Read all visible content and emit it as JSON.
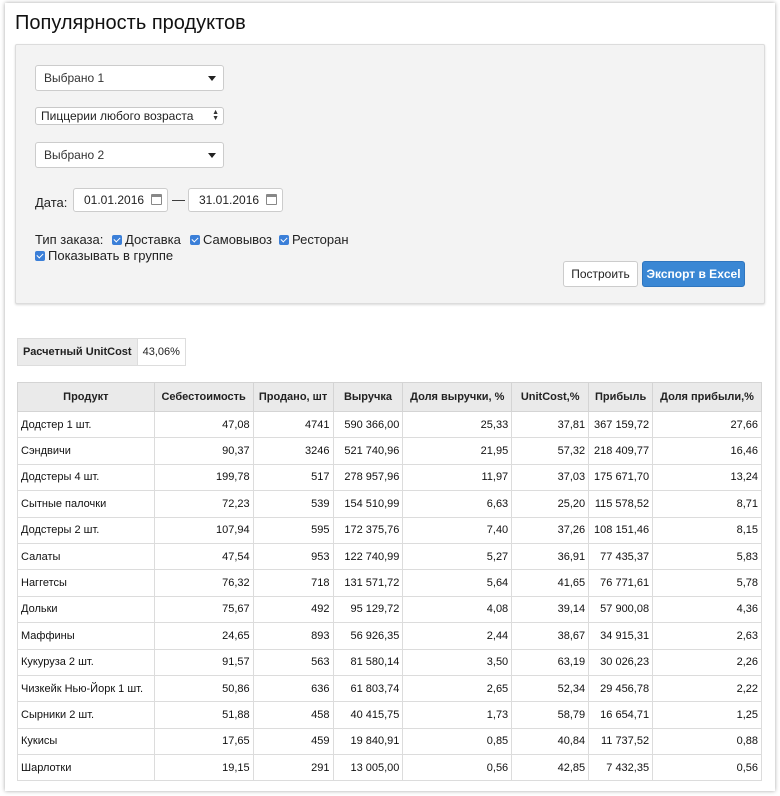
{
  "page": {
    "title": "Популярность продуктов"
  },
  "filters": {
    "select1": "Выбрано 1",
    "select_pizzeria": "Пиццерии любого возраста",
    "select2": "Выбрано 2",
    "date_label": "Дата:",
    "date_from": "01.01.2016",
    "date_sep": "—",
    "date_to": "31.01.2016",
    "order_type_label": "Тип заказа:",
    "order_types": [
      {
        "label": "Доставка",
        "checked": true
      },
      {
        "label": "Самовывоз",
        "checked": true
      },
      {
        "label": "Ресторан",
        "checked": true
      }
    ],
    "show_in_group": {
      "label": "Показывать в группе",
      "checked": true
    },
    "build_label": "Построить",
    "export_label": "Экспорт в Excel"
  },
  "unitcost": {
    "label": "Расчетный UnitCost",
    "value": "43,06%"
  },
  "table": {
    "headers": [
      "Продукт",
      "Себестоимость",
      "Продано, шт",
      "Выручка",
      "Доля выручки, %",
      "UnitCost,%",
      "Прибыль",
      "Доля прибыли,%"
    ],
    "rows": [
      [
        "Додстер 1 шт.",
        "47,08",
        "4741",
        "590 366,00",
        "25,33",
        "37,81",
        "367 159,72",
        "27,66"
      ],
      [
        "Сэндвичи",
        "90,37",
        "3246",
        "521 740,96",
        "21,95",
        "57,32",
        "218 409,77",
        "16,46"
      ],
      [
        "Додстеры 4 шт.",
        "199,78",
        "517",
        "278 957,96",
        "11,97",
        "37,03",
        "175 671,70",
        "13,24"
      ],
      [
        "Сытные палочки",
        "72,23",
        "539",
        "154 510,99",
        "6,63",
        "25,20",
        "115 578,52",
        "8,71"
      ],
      [
        "Додстеры 2 шт.",
        "107,94",
        "595",
        "172 375,76",
        "7,40",
        "37,26",
        "108 151,46",
        "8,15"
      ],
      [
        "Салаты",
        "47,54",
        "953",
        "122 740,99",
        "5,27",
        "36,91",
        "77 435,37",
        "5,83"
      ],
      [
        "Наггетсы",
        "76,32",
        "718",
        "131 571,72",
        "5,64",
        "41,65",
        "76 771,61",
        "5,78"
      ],
      [
        "Дольки",
        "75,67",
        "492",
        "95 129,72",
        "4,08",
        "39,14",
        "57 900,08",
        "4,36"
      ],
      [
        "Маффины",
        "24,65",
        "893",
        "56 926,35",
        "2,44",
        "38,67",
        "34 915,31",
        "2,63"
      ],
      [
        "Кукуруза 2 шт.",
        "91,57",
        "563",
        "81 580,14",
        "3,50",
        "63,19",
        "30 026,23",
        "2,26"
      ],
      [
        "Чизкейк Нью-Йорк 1 шт.",
        "50,86",
        "636",
        "61 803,74",
        "2,65",
        "52,34",
        "29 456,78",
        "2,22"
      ],
      [
        "Сырники 2 шт.",
        "51,88",
        "458",
        "40 415,75",
        "1,73",
        "58,79",
        "16 654,71",
        "1,25"
      ],
      [
        "Кукисы",
        "17,65",
        "459",
        "19 840,91",
        "0,85",
        "40,84",
        "11 737,52",
        "0,88"
      ],
      [
        "Шарлотки",
        "19,15",
        "291",
        "13 005,00",
        "0,56",
        "42,85",
        "7 432,35",
        "0,56"
      ]
    ]
  }
}
